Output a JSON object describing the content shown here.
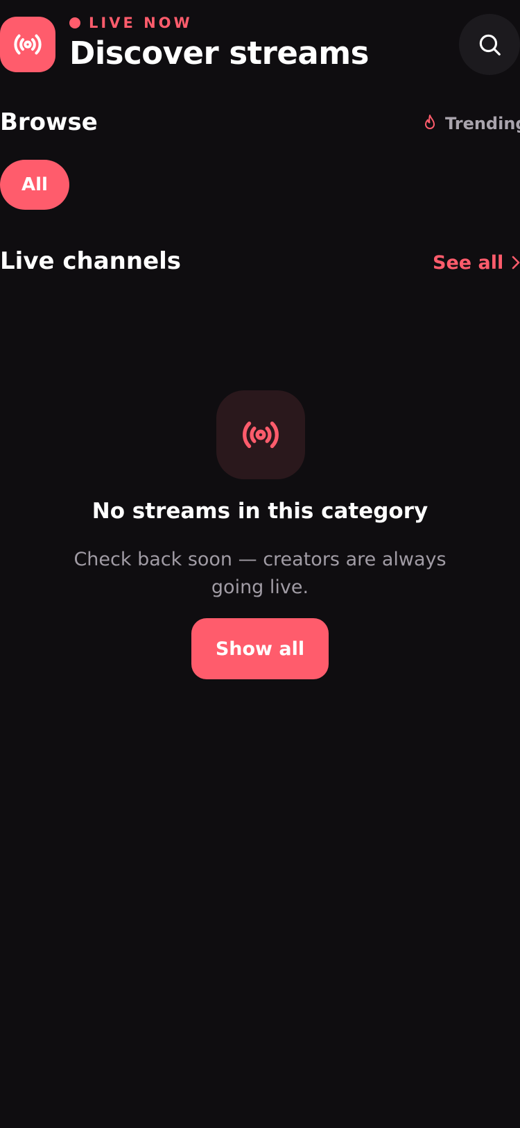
{
  "header": {
    "live_label": "LIVE NOW",
    "title": "Discover streams",
    "logo_icon": "broadcast-icon",
    "search_icon": "search-icon"
  },
  "browse": {
    "title": "Browse",
    "trending_label": "Trending",
    "trending_icon": "flame-icon",
    "chips": [
      {
        "label": "All",
        "selected": true
      }
    ]
  },
  "live_channels": {
    "title": "Live channels",
    "see_all_label": "See all",
    "see_all_icon": "chevron-right-icon"
  },
  "empty_state": {
    "icon": "broadcast-icon",
    "title": "No streams in this category",
    "description": "Check back soon — creators are always going live.",
    "button_label": "Show all"
  },
  "colors": {
    "background": "#0f0d10",
    "accent": "#ff5c6c",
    "muted_text": "#a19ca5",
    "surface": "#1c1a1e",
    "accent_tint": "#2a181c"
  }
}
